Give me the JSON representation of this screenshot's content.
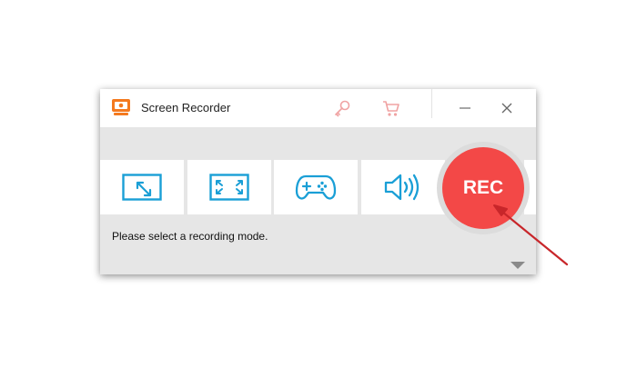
{
  "window": {
    "title": "Screen Recorder",
    "icons": {
      "app": "screen-recorder-app-icon",
      "register": "key-icon",
      "buy": "cart-icon",
      "minimize": "minimize-icon",
      "close": "close-icon"
    }
  },
  "modes": [
    {
      "name": "custom-region",
      "icon": "custom-region-icon"
    },
    {
      "name": "fullscreen",
      "icon": "fullscreen-icon"
    },
    {
      "name": "game",
      "icon": "gamepad-icon"
    },
    {
      "name": "audio-only",
      "icon": "speaker-icon"
    }
  ],
  "rec_button": {
    "label": "REC"
  },
  "status": {
    "message": "Please select a recording mode."
  },
  "colors": {
    "accent_blue": "#1a9fd6",
    "rec_red": "#f34847",
    "annotation_arrow": "#c8262a",
    "window_bg": "#e6e6e6"
  }
}
